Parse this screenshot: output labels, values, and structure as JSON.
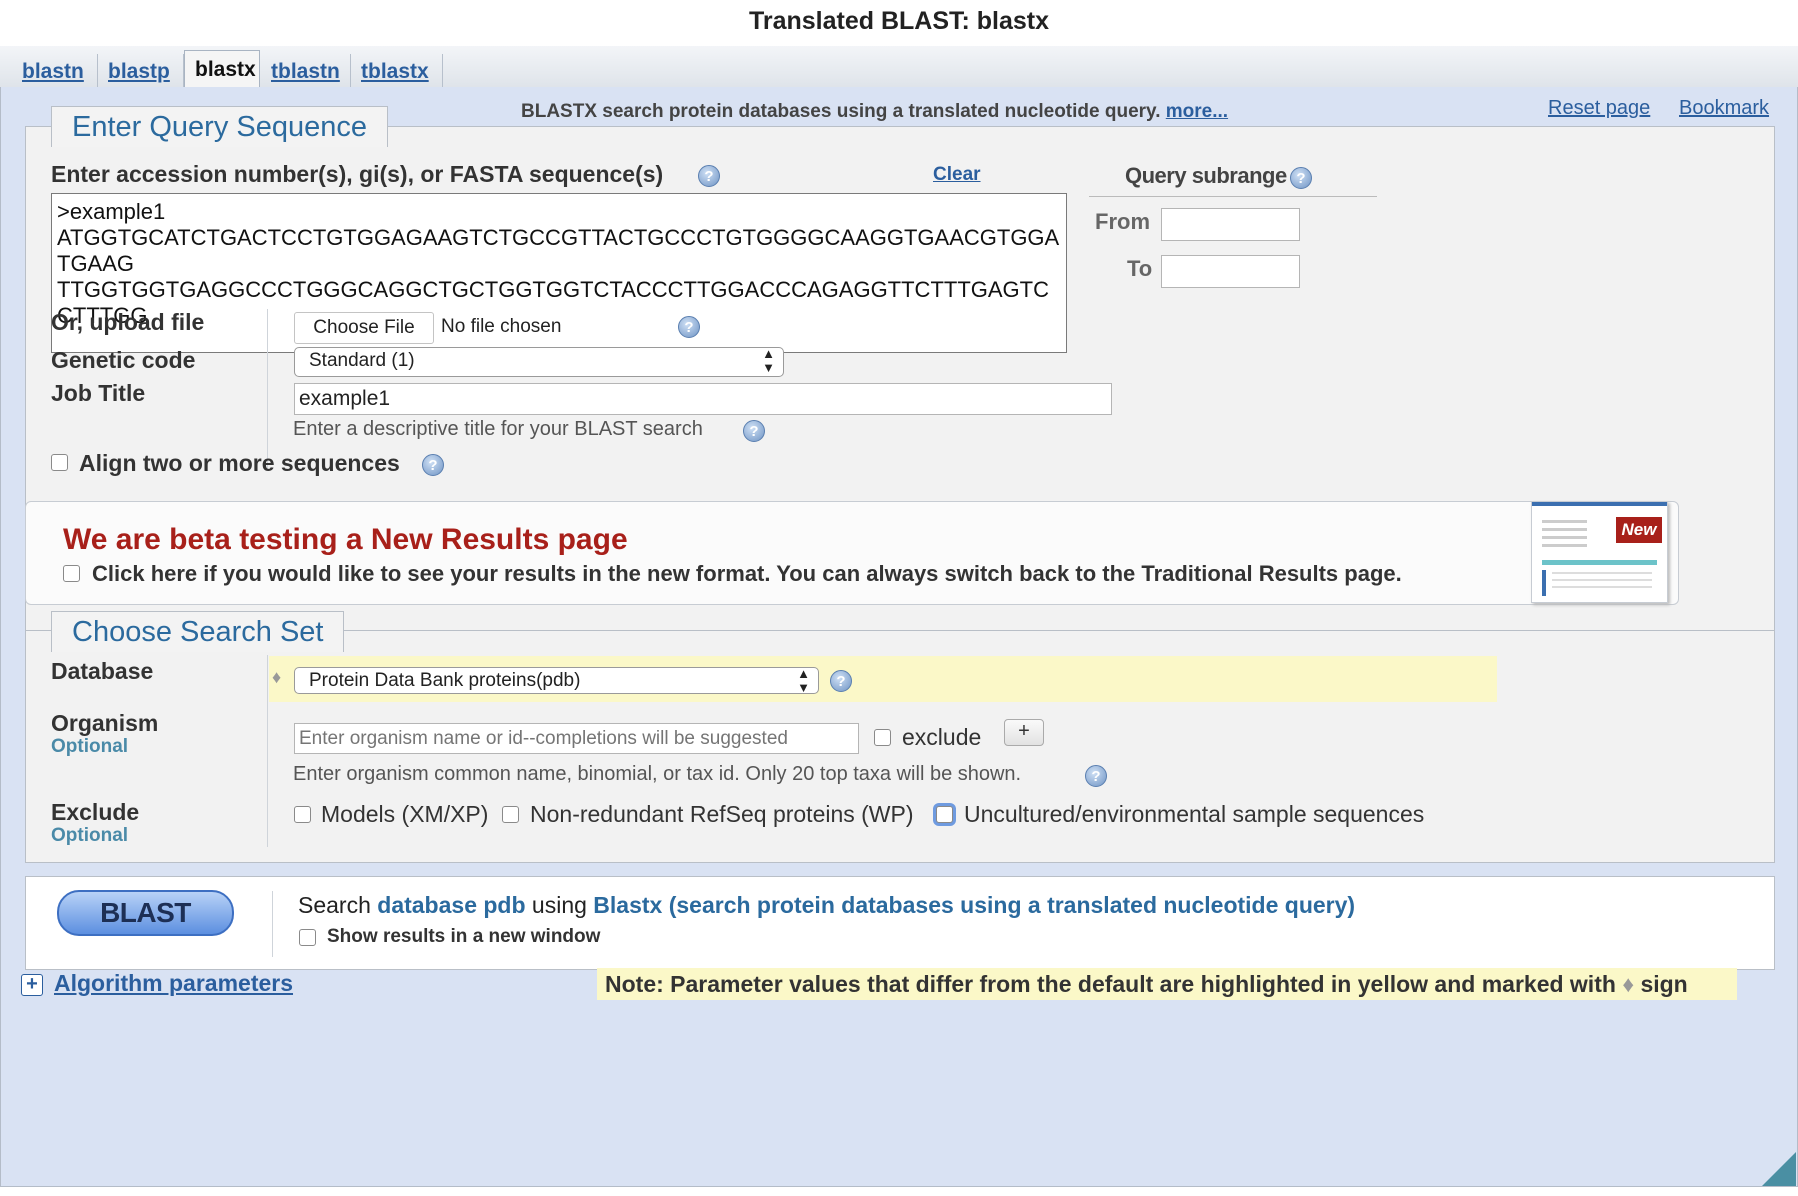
{
  "page": {
    "title": "Translated BLAST: blastx"
  },
  "tabs": [
    {
      "label": "blastn"
    },
    {
      "label": "blastp"
    },
    {
      "label": "blastx"
    },
    {
      "label": "tblastn"
    },
    {
      "label": "tblastx"
    }
  ],
  "header": {
    "description": "BLASTX search protein databases using a translated nucleotide query.",
    "more_link": "more...",
    "reset_link": "Reset page",
    "bookmark_link": "Bookmark"
  },
  "query": {
    "legend": "Enter Query Sequence",
    "label": "Enter accession number(s), gi(s), or FASTA sequence(s)",
    "clear_link": "Clear",
    "sequence": ">example1\nATGGTGCATCTGACTCCTGTGGAGAAGTCTGCCGTTACTGCCCTGTGGGGCAAGGTGAACGTGGATGAAG\nTTGGTGGTGAGGCCCTGGGCAGGCTGCTGGTGGTCTACCCTTGGACCCAGAGGTTCTTTGAGTCCTTTGG",
    "subrange_title": "Query subrange",
    "from_label": "From",
    "to_label": "To",
    "from_value": "",
    "to_value": "",
    "upload_label": "Or, upload file",
    "choose_file_button": "Choose File",
    "no_file_text": "No file chosen",
    "genetic_code_label": "Genetic code",
    "genetic_code_value": "Standard (1)",
    "job_title_label": "Job Title",
    "job_title_value": "example1",
    "job_title_hint": "Enter a descriptive title for your BLAST search",
    "align_label": "Align two or more sequences"
  },
  "beta": {
    "headline": "We are beta testing a New Results page",
    "checkbox_label": "Click here if you would like to see your results in the new format. You can always switch back to the Traditional Results page.",
    "badge": "New"
  },
  "search_set": {
    "legend": "Choose Search Set",
    "database_label": "Database",
    "database_value": "Protein Data Bank proteins(pdb)",
    "organism_label": "Organism",
    "optional_label": "Optional",
    "organism_placeholder": "Enter organism name or id--completions will be suggested",
    "exclude_checkbox_label": "exclude",
    "add_button": "+",
    "organism_hint": "Enter organism common name, binomial, or tax id. Only 20 top taxa will be shown.",
    "exclude_label": "Exclude",
    "exclude_optional_label": "Optional",
    "exclude_options": [
      "Models (XM/XP)",
      "Non-redundant RefSeq proteins (WP)",
      "Uncultured/environmental sample sequences"
    ]
  },
  "submit": {
    "button_label": "BLAST",
    "search_prefix": "Search",
    "database_phrase": "database pdb",
    "using_word": "using",
    "program_phrase": "Blastx (search protein databases using a translated nucleotide query)",
    "new_window_label": "Show results in a new window"
  },
  "footer": {
    "algorithm_link": "Algorithm parameters",
    "note": "Note: Parameter values that differ from the default are highlighted in yellow and marked with",
    "note_sign": "sign"
  },
  "colors": {
    "link_blue": "#2b5e9e",
    "legend_blue": "#2b6a9e",
    "beta_red": "#a8201a",
    "highlight_yellow": "#fbf8c8",
    "panel_bg": "#d9e2f3"
  }
}
